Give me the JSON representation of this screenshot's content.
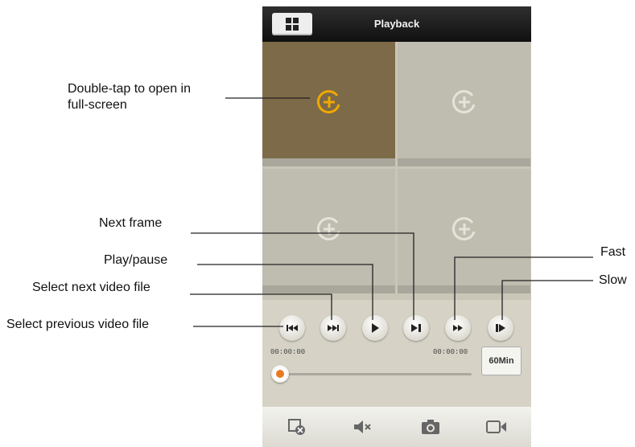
{
  "header": {
    "title": "Playback",
    "grid_icon": "grid-icon"
  },
  "camera_cells": [
    {
      "state": "selected",
      "icon": "add-circle-icon",
      "color": "#7d6a48"
    },
    {
      "state": "idle",
      "icon": "add-circle-icon",
      "color": "#bfbcb0"
    },
    {
      "state": "idle",
      "icon": "add-circle-icon",
      "color": "#bfbcb0"
    },
    {
      "state": "idle",
      "icon": "add-circle-icon",
      "color": "#bfbcb0"
    }
  ],
  "controls": {
    "buttons": [
      {
        "icon": "skip-previous-icon"
      },
      {
        "icon": "skip-next-icon"
      },
      {
        "icon": "play-icon"
      },
      {
        "icon": "next-frame-icon"
      },
      {
        "icon": "fast-forward-icon"
      },
      {
        "icon": "slow-icon"
      }
    ],
    "time_start": "00:00:00",
    "time_end": "00:00:00",
    "duration_label": "60Min",
    "progress_fraction": 0
  },
  "bottom_toolbar": [
    {
      "icon": "close-all-icon"
    },
    {
      "icon": "mute-icon"
    },
    {
      "icon": "snapshot-camera-icon"
    },
    {
      "icon": "record-video-icon"
    }
  ],
  "annotations": {
    "double_tap": "Double-tap to open in\nfull-screen",
    "next_frame": "Next frame",
    "play_pause": "Play/pause",
    "select_next": "Select next video file",
    "select_previous": "Select previous video file",
    "fast": "Fast",
    "slow": "Slow"
  },
  "colors": {
    "accent": "#e8a21a",
    "title_bar": "#1a1a1a",
    "leader_line": "#222222"
  }
}
